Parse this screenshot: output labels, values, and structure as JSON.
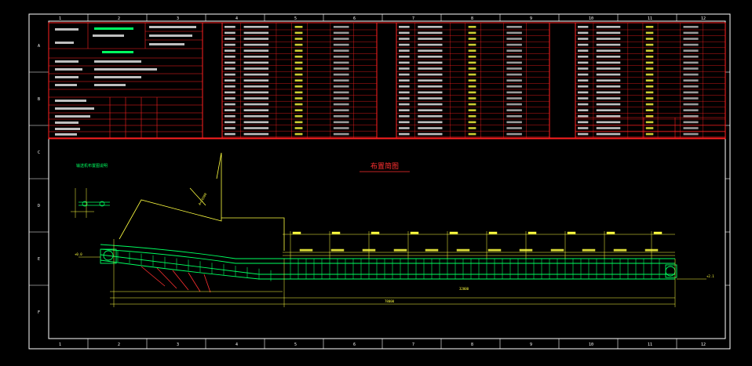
{
  "drawing": {
    "plan_title": "布置简图",
    "green_note": "输送机布置图说明",
    "upper_left_label": "DTII(A)带式输送机",
    "dims": {
      "overall_length": "78000",
      "bottom_run": "32000",
      "right_level": "+2.1",
      "left_level": "+0.0",
      "incline_dim": "A=16500"
    },
    "frame_numbers": [
      "1",
      "2",
      "3",
      "4",
      "5",
      "6",
      "7",
      "8",
      "9",
      "10",
      "11",
      "12"
    ],
    "row_letters": [
      "A",
      "B",
      "C",
      "D",
      "E",
      "F"
    ],
    "colors": {
      "background": "#000000",
      "frame": "#ffffff",
      "title_block": "#ff2020",
      "text": "#ffffff",
      "conveyor": "#00ff60",
      "dimension": "#ffff40",
      "heading": "#ff3030"
    }
  }
}
